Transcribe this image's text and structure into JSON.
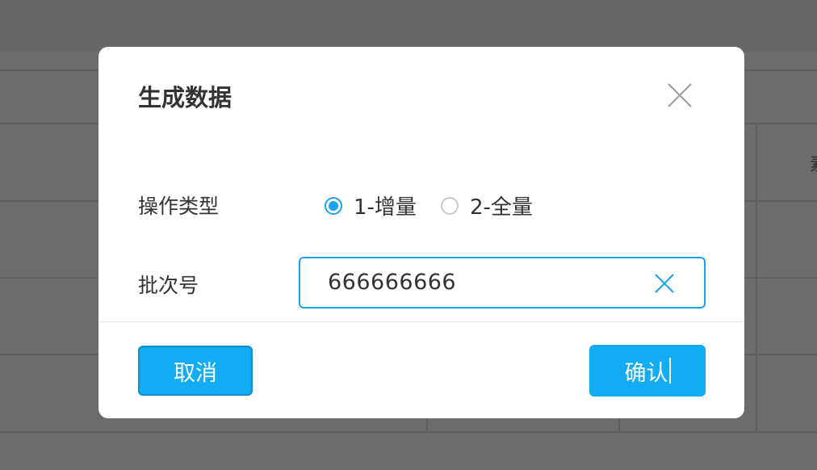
{
  "dialog": {
    "title": "生成数据",
    "fields": {
      "operation_type_label": "操作类型",
      "batch_number_label": "批次号"
    },
    "radio_options": [
      {
        "label": "1-增量",
        "checked": true
      },
      {
        "label": "2-全量",
        "checked": false
      }
    ],
    "batch_input": {
      "value": "666666666"
    },
    "buttons": {
      "cancel": "取消",
      "confirm": "确认"
    }
  },
  "background": {
    "clipped_text": "素"
  },
  "colors": {
    "accent": "#13acf2",
    "overlay": "#6b6b6b",
    "text": "#333333"
  },
  "icons": {
    "close": "close-icon",
    "clear": "clear-icon"
  }
}
